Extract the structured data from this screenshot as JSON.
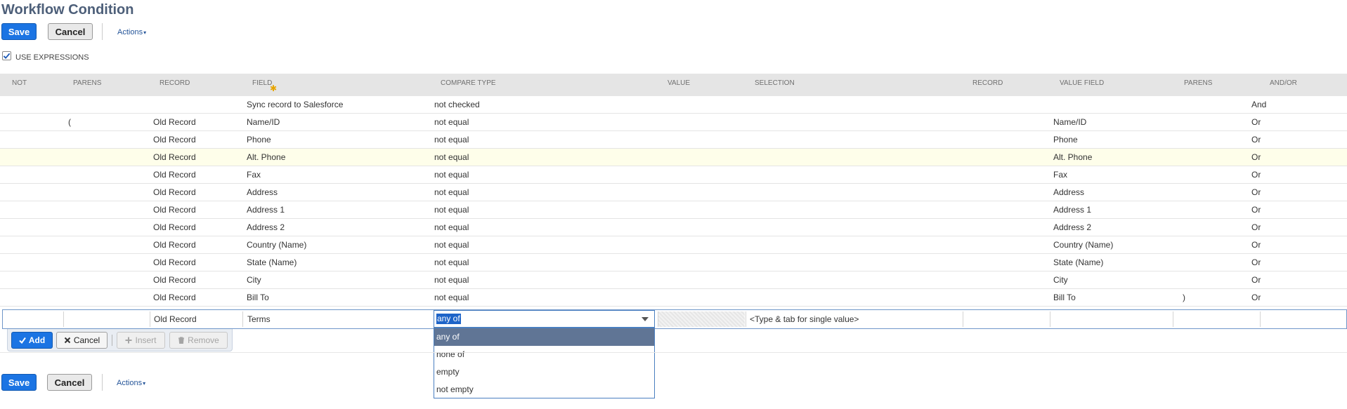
{
  "page": {
    "title": "Workflow Condition"
  },
  "toolbar": {
    "save_label": "Save",
    "cancel_label": "Cancel",
    "actions_label": "Actions",
    "actions_caret": "▾"
  },
  "use_expressions": {
    "label": "USE EXPRESSIONS",
    "checked": true
  },
  "columns": {
    "not": "NOT",
    "parens": "PARENS",
    "record": "RECORD",
    "field": "FIELD",
    "field_required": "✱",
    "compare_type": "COMPARE TYPE",
    "value": "VALUE",
    "selection": "SELECTION",
    "record2": "RECORD",
    "value_field": "VALUE FIELD",
    "parens2": "PARENS",
    "and_or": "AND/OR"
  },
  "rows": [
    {
      "not": "",
      "parens": "",
      "record": "",
      "field": "Sync record to Salesforce",
      "compare": "not checked",
      "value": "",
      "selection": "",
      "record2": "",
      "value_field": "",
      "parens2": "",
      "and_or": "And"
    },
    {
      "not": "",
      "parens": "(",
      "record": "Old Record",
      "field": "Name/ID",
      "compare": "not equal",
      "value": "",
      "selection": "",
      "record2": "",
      "value_field": "Name/ID",
      "parens2": "",
      "and_or": "Or"
    },
    {
      "not": "",
      "parens": "",
      "record": "Old Record",
      "field": "Phone",
      "compare": "not equal",
      "value": "",
      "selection": "",
      "record2": "",
      "value_field": "Phone",
      "parens2": "",
      "and_or": "Or"
    },
    {
      "not": "",
      "parens": "",
      "record": "Old Record",
      "field": "Alt. Phone",
      "compare": "not equal",
      "value": "",
      "selection": "",
      "record2": "",
      "value_field": "Alt. Phone",
      "parens2": "",
      "and_or": "Or"
    },
    {
      "not": "",
      "parens": "",
      "record": "Old Record",
      "field": "Fax",
      "compare": "not equal",
      "value": "",
      "selection": "",
      "record2": "",
      "value_field": "Fax",
      "parens2": "",
      "and_or": "Or"
    },
    {
      "not": "",
      "parens": "",
      "record": "Old Record",
      "field": "Address",
      "compare": "not equal",
      "value": "",
      "selection": "",
      "record2": "",
      "value_field": "Address",
      "parens2": "",
      "and_or": "Or"
    },
    {
      "not": "",
      "parens": "",
      "record": "Old Record",
      "field": "Address 1",
      "compare": "not equal",
      "value": "",
      "selection": "",
      "record2": "",
      "value_field": "Address 1",
      "parens2": "",
      "and_or": "Or"
    },
    {
      "not": "",
      "parens": "",
      "record": "Old Record",
      "field": "Address 2",
      "compare": "not equal",
      "value": "",
      "selection": "",
      "record2": "",
      "value_field": "Address 2",
      "parens2": "",
      "and_or": "Or"
    },
    {
      "not": "",
      "parens": "",
      "record": "Old Record",
      "field": "Country (Name)",
      "compare": "not equal",
      "value": "",
      "selection": "",
      "record2": "",
      "value_field": "Country (Name)",
      "parens2": "",
      "and_or": "Or"
    },
    {
      "not": "",
      "parens": "",
      "record": "Old Record",
      "field": "State (Name)",
      "compare": "not equal",
      "value": "",
      "selection": "",
      "record2": "",
      "value_field": "State (Name)",
      "parens2": "",
      "and_or": "Or"
    },
    {
      "not": "",
      "parens": "",
      "record": "Old Record",
      "field": "City",
      "compare": "not equal",
      "value": "",
      "selection": "",
      "record2": "",
      "value_field": "City",
      "parens2": "",
      "and_or": "Or"
    },
    {
      "not": "",
      "parens": "",
      "record": "Old Record",
      "field": "Bill To",
      "compare": "not equal",
      "value": "",
      "selection": "",
      "record2": "",
      "value_field": "Bill To",
      "parens2": ")",
      "and_or": "Or"
    }
  ],
  "edit_row": {
    "record": "Old Record",
    "field": "Terms",
    "compare_selected": "any of",
    "selection_placeholder": "<Type & tab for single value>"
  },
  "compare_options": [
    "any of",
    "none of",
    "empty",
    "not empty"
  ],
  "row_controls": {
    "add_label": "Add",
    "cancel_label": "Cancel",
    "insert_label": "Insert",
    "remove_label": "Remove"
  },
  "colors": {
    "primary_button": "#1b74e3",
    "title": "#4d5f79",
    "highlight_row": "#fefeea",
    "dropdown_selected": "#607595"
  }
}
